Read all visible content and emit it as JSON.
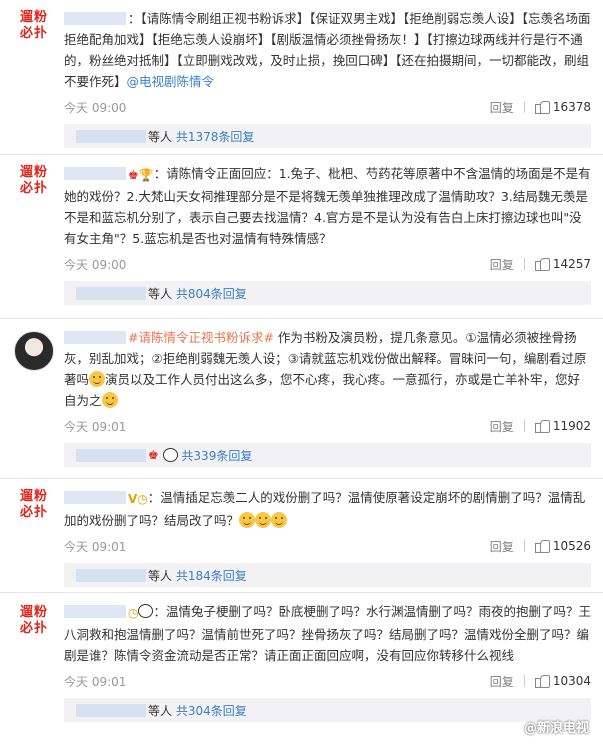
{
  "comments": [
    {
      "avatar_text": [
        "遛粉",
        "必扑"
      ],
      "segments": [
        {
          "t": "：【请陈情令刷组正视书粉诉求】【保证双男主戏】【拒绝削弱忘羡人设】【忘羡名场面拒绝配角加戏】【拒绝忘羡人设崩坏】【剧版温情必须挫骨扬灰！】【打擦边球两线并行是行不通的，粉丝绝对抵制】【立即删戏改戏，及时止损，挽回口碑】【还在拍摄期间，一切都能改，刷组不要作死】",
          "c": ""
        },
        {
          "t": "@电视剧陈情令",
          "c": "blue"
        }
      ],
      "time": "今天 09:00",
      "reply": "回复",
      "likes": "16378",
      "summary": {
        "suffix": "等人",
        "link": "共1378条回复"
      }
    },
    {
      "avatar_text": [
        "遛粉",
        "必扑"
      ],
      "segments": [
        {
          "t": "：请陈情令正面回应：1.兔子、枇杷、芍药花等原著中不含温情的场面是不是有她的戏份？2.大梵山天女祠推理部分是不是将魏无羡单独推理改成了温情助攻？3.结局魏无羡是不是和蓝忘机分别了，表示自己要去找温情？4.官方是不是认为没有告白上床打擦边球也叫\"没有女主角\"？5.蓝忘机是否也对温情有特殊情感？",
          "c": ""
        }
      ],
      "time": "今天 09:00",
      "reply": "回复",
      "likes": "14257",
      "summary": {
        "suffix": "等人",
        "link": "共804条回复"
      }
    },
    {
      "avatar_text": [
        "",
        ""
      ],
      "segments": [
        {
          "t": "#请陈情令正视书粉诉求#",
          "c": "link"
        },
        {
          "t": " 作为书粉及演员粉，提几条意见。①温情必须被挫骨扬灰，别乱加戏；②拒绝削弱魏无羡人设；③请就蓝忘机戏份做出解释。冒昧问一句，编剧看过原著吗",
          "c": ""
        },
        {
          "t": "演员以及工作人员付出这么多，您不心疼，我心疼。一意孤行，亦或是亡羊补牢，您好自为之",
          "c": ""
        }
      ],
      "time": "今天 09:01",
      "reply": "回复",
      "likes": "11902",
      "summary": {
        "suffix": "",
        "link": "共339条回复"
      }
    },
    {
      "avatar_text": [
        "遛粉",
        "必扑"
      ],
      "segments": [
        {
          "t": "：温情插足忘羡二人的戏份删了吗？温情使原著设定崩坏的剧情删了吗？温情乱加的戏份删了吗？结局改了吗？",
          "c": ""
        }
      ],
      "time": "今天 09:01",
      "reply": "回复",
      "likes": "10526",
      "summary": {
        "suffix": "等人",
        "link": "共184条回复"
      }
    },
    {
      "avatar_text": [
        "遛粉",
        "必扑"
      ],
      "segments": [
        {
          "t": "：温情兔子梗删了吗？卧底梗删了吗？水行渊温情删了吗？雨夜的抱删了吗？王八洞救和抱温情删了吗？温情前世死了吗？挫骨扬灰了吗？结局删了吗？温情戏份全删了吗？编剧是谁？陈情令资金流动是否正常？请正面正面回应啊，没有回应你转移什么视线",
          "c": ""
        }
      ],
      "time": "今天 09:01",
      "reply": "回复",
      "likes": "10304",
      "summary": {
        "suffix": "等人",
        "link": "共304条回复"
      }
    }
  ],
  "watermark": "@新浪电视"
}
